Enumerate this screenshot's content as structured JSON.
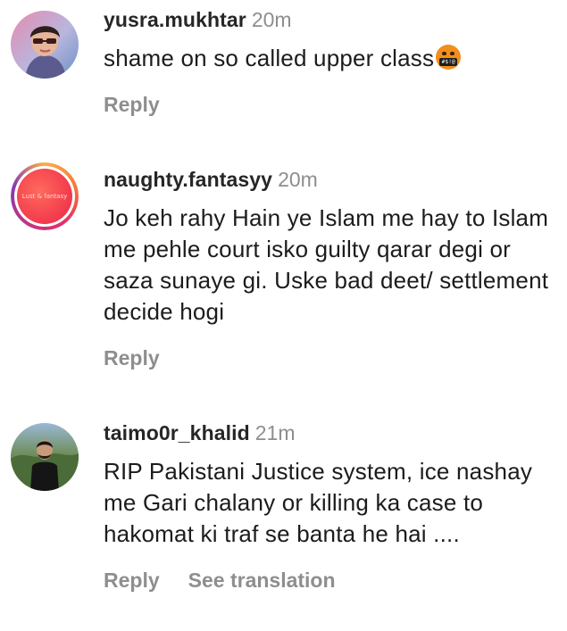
{
  "comments": [
    {
      "username": "yusra.mukhtar",
      "time": "20m",
      "text": "shame on so called upper class",
      "emoji_name": "face-with-symbols-on-mouth-emoji",
      "reply": "Reply"
    },
    {
      "username": "naughty.fantasyy",
      "time": "20m",
      "avatar_caption": "Lust & fantasy",
      "text": "Jo keh rahy Hain ye Islam me hay to Islam me pehle court isko guilty qarar degi or saza sunaye gi. Uske bad deet/ settlement decide hogi",
      "reply": "Reply"
    },
    {
      "username": "taimo0r_khalid",
      "time": "21m",
      "text": "RIP Pakistani Justice system, ice nashay me Gari chalany or killing ka case to hakomat ki traf se banta he hai ....",
      "reply": "Reply",
      "see_translation": "See translation"
    }
  ],
  "colors": {
    "text": "#262626",
    "muted": "#8e8e8e",
    "story_ring_start": "#fcaf45",
    "story_ring_end": "#833ab4"
  }
}
